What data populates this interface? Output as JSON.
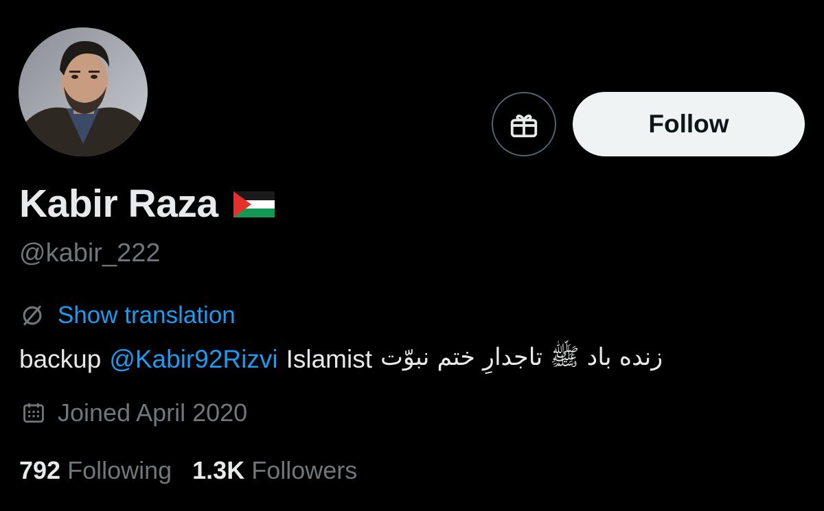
{
  "profile": {
    "display_name": "Kabir Raza",
    "flag_icon": "palestine-flag-emoji",
    "handle": "@kabir_222",
    "follow_label": "Follow",
    "gift_icon": "gift-icon"
  },
  "translation": {
    "icon": "translate-globe-icon",
    "label": "Show translation"
  },
  "bio": {
    "prefix": "backup",
    "mention": "@Kabir92Rizvi",
    "word": "Islamist",
    "arabic": "زنده باد ﷺ تاجدارِ ختم نبوّت"
  },
  "joined": {
    "icon": "calendar-icon",
    "label": "Joined April 2020"
  },
  "stats": {
    "following_count": "792",
    "following_label": "Following",
    "followers_count": "1.3K",
    "followers_label": "Followers"
  },
  "colors": {
    "background": "#000000",
    "text_primary": "#e7e9ea",
    "text_secondary": "#71767b",
    "link": "#1d9bf0",
    "follow_button_bg": "#eff3f4",
    "border": "#536471"
  }
}
